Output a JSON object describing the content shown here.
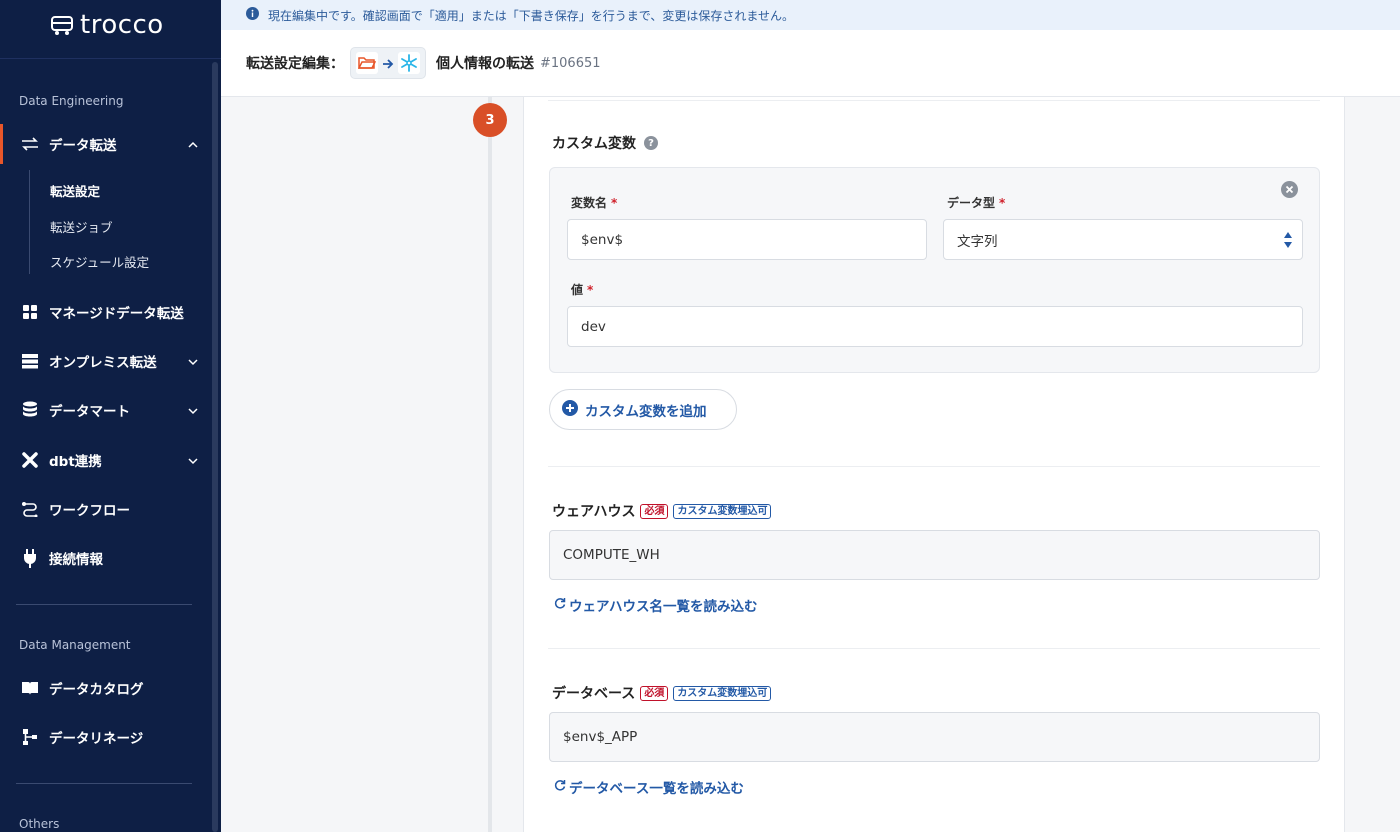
{
  "app": {
    "logo_text": "trocco"
  },
  "infobar": {
    "text": "現在編集中です。確認画面で「適用」または「下書き保存」を行うまで、変更は保存されません。"
  },
  "header": {
    "label": "転送設定編集：",
    "title": "個人情報の転送",
    "id": "#106651"
  },
  "sidebar": {
    "sections": {
      "data_engineering": "Data Engineering",
      "data_management": "Data Management",
      "others": "Others"
    },
    "items": [
      {
        "label": "データ転送",
        "icon": "transfer-icon"
      },
      {
        "label": "マネージドデータ転送",
        "icon": "grid-icon"
      },
      {
        "label": "オンプレミス転送",
        "icon": "server-icon"
      },
      {
        "label": "データマート",
        "icon": "database-icon"
      },
      {
        "label": "dbt連携",
        "icon": "dbt-icon"
      },
      {
        "label": "ワークフロー",
        "icon": "workflow-icon"
      },
      {
        "label": "接続情報",
        "icon": "plug-icon"
      },
      {
        "label": "データカタログ",
        "icon": "book-icon"
      },
      {
        "label": "データリネージ",
        "icon": "lineage-icon"
      }
    ],
    "sub_items": [
      "転送設定",
      "転送ジョブ",
      "スケジュール設定"
    ]
  },
  "step": {
    "number": "3"
  },
  "custom_vars": {
    "title": "カスタム変数",
    "name_label": "変数名",
    "type_label": "データ型",
    "value_label": "値",
    "required_mark": "*",
    "name_value": "$env$",
    "type_value": "文字列",
    "value_value": "dev",
    "add_label": "カスタム変数を追加"
  },
  "warehouse": {
    "title": "ウェアハウス",
    "tag_required": "必須",
    "tag_var": "カスタム変数埋込可",
    "value": "COMPUTE_WH",
    "load_link": "ウェアハウス名一覧を読み込む"
  },
  "database": {
    "title": "データベース",
    "tag_required": "必須",
    "tag_var": "カスタム変数埋込可",
    "value": "$env$_APP",
    "load_link": "データベース一覧を読み込む"
  },
  "colors": {
    "sidebar_bg": "#0e1f45",
    "accent": "#d94f27",
    "link": "#2359a6"
  }
}
